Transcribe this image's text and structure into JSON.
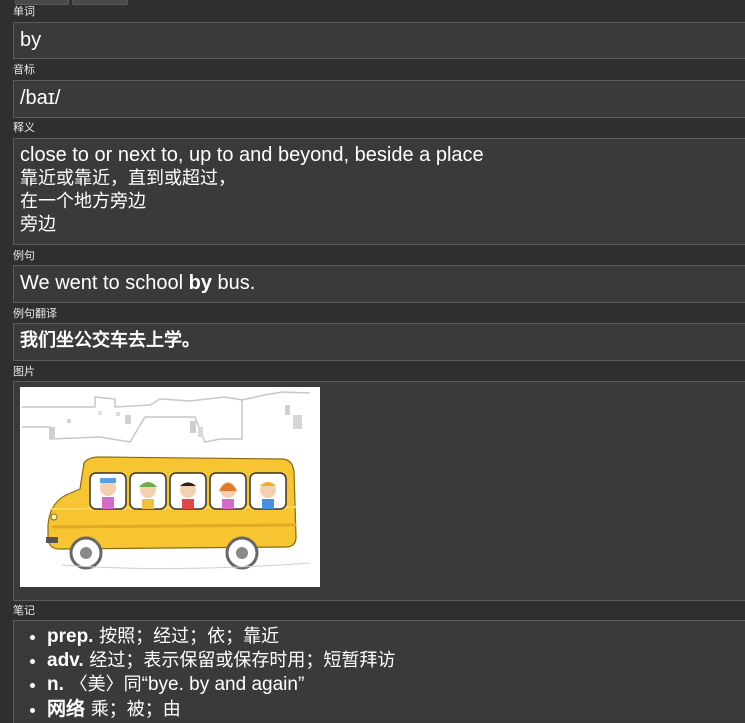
{
  "fields": {
    "word": {
      "label": "单词",
      "value": "by"
    },
    "phonetic": {
      "label": "音标",
      "value": "/baɪ/"
    },
    "definition": {
      "label": "释义",
      "lines": [
        "close to or next to, up to and beyond, beside a place",
        "靠近或靠近，直到或超过，",
        "在一个地方旁边",
        "旁边"
      ]
    },
    "example": {
      "label": "例句",
      "before": "We went to school ",
      "bold": "by",
      "after": " bus."
    },
    "example_translation": {
      "label": "例句翻译",
      "value": "我们坐公交车去上学。"
    },
    "picture": {
      "label": "图片"
    },
    "notes": {
      "label": "笔记",
      "items": [
        {
          "pos": "prep.",
          "text": " 按照；经过；依；靠近"
        },
        {
          "pos": "adv.",
          "text": " 经过；表示保留或保存时用；短暂拜访"
        },
        {
          "pos": "n.",
          "text": " 〈美〉同",
          "en": "“bye. by and again”"
        },
        {
          "pos": "网络",
          "text": " 乘；被；由"
        }
      ]
    }
  },
  "colors": {
    "background": "#2f2f2f",
    "field_background": "#3a3a3a",
    "field_border": "#5c5c5c",
    "bus_yellow": "#f7c531"
  }
}
